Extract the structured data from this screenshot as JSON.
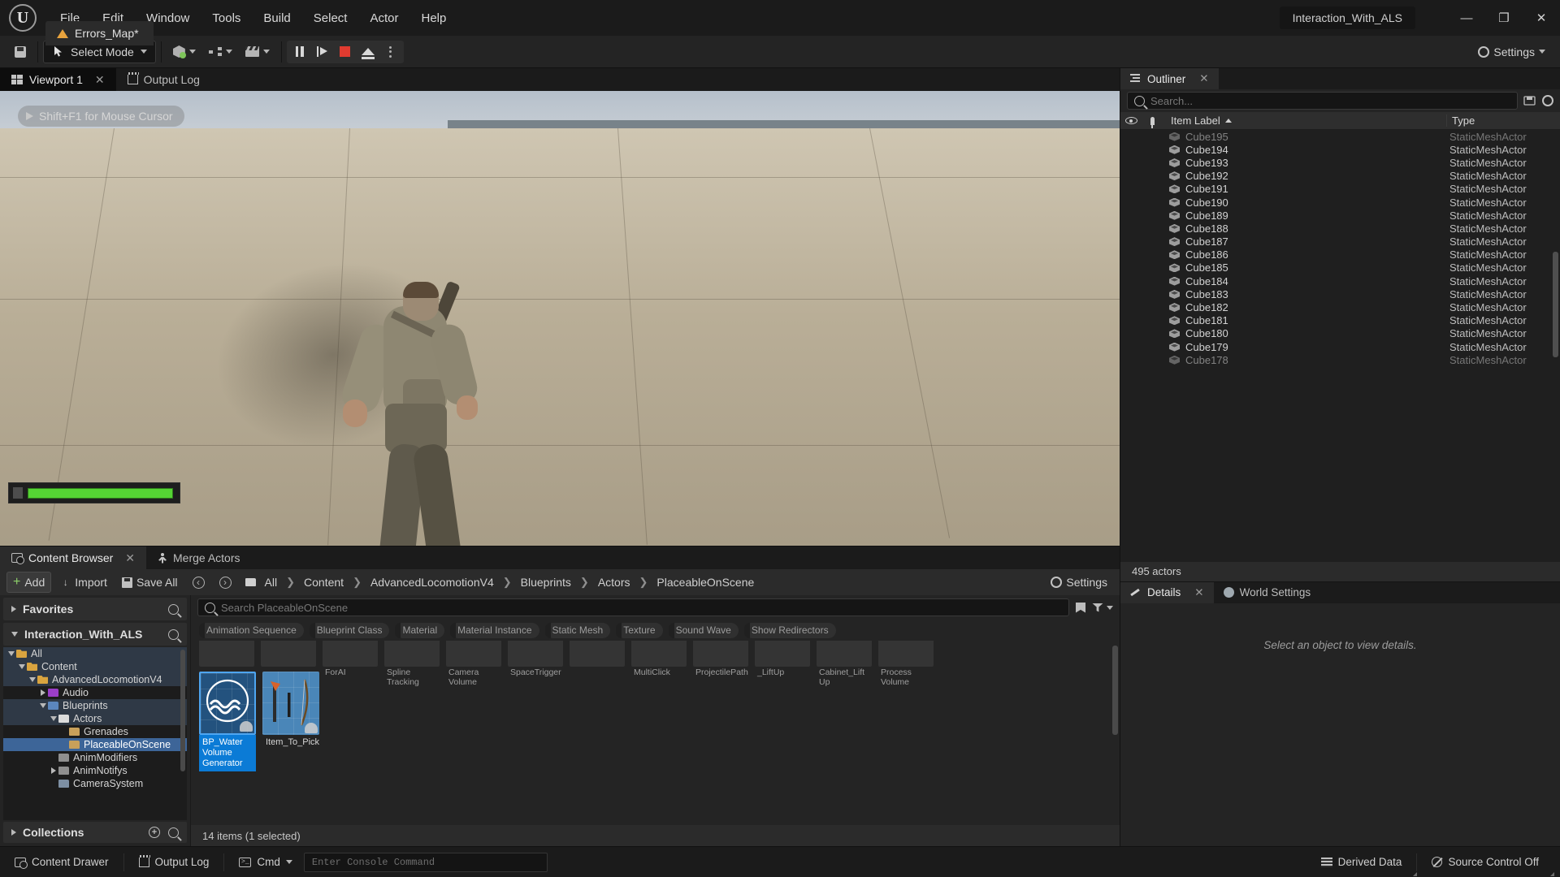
{
  "titlebar": {
    "menu": [
      "File",
      "Edit",
      "Window",
      "Tools",
      "Build",
      "Select",
      "Actor",
      "Help"
    ],
    "project_name": "Interaction_With_ALS",
    "level_tab": "Errors_Map*",
    "minimize": "—",
    "maximize": "❐",
    "close": "✕"
  },
  "toolbar": {
    "save_label": "",
    "mode_label": "Select Mode",
    "settings_label": "Settings",
    "icons": {
      "save": "save-icon",
      "select_mode": "cursor-icon",
      "add_actor": "place-actor-icon",
      "blueprints": "blueprint-icon",
      "cinematics": "cinematics-icon",
      "pause": "pause-icon",
      "step": "step-icon",
      "stop": "stop-icon",
      "eject": "eject-icon",
      "more": "more-options-icon",
      "settings": "gear-icon"
    }
  },
  "viewport": {
    "tabs": [
      {
        "label": "Viewport 1",
        "icon": "viewport-icon",
        "active": true,
        "closable": true
      },
      {
        "label": "Output Log",
        "icon": "output-log-icon",
        "active": false,
        "closable": false
      }
    ],
    "overlay_hint": "Shift+F1 for Mouse Cursor",
    "health_percent": 100
  },
  "outliner": {
    "tab_label": "Outliner",
    "tab_icon": "outliner-icon",
    "close_label": "✕",
    "search_placeholder": "Search...",
    "columns": {
      "eye": "visibility-icon",
      "pin": "pin-icon",
      "item_label": "Item Label",
      "type": "Type"
    },
    "sort_ascending": true,
    "rows": [
      {
        "name": "Cube178",
        "type": "StaticMeshActor",
        "clipped": true
      },
      {
        "name": "Cube179",
        "type": "StaticMeshActor"
      },
      {
        "name": "Cube180",
        "type": "StaticMeshActor"
      },
      {
        "name": "Cube181",
        "type": "StaticMeshActor"
      },
      {
        "name": "Cube182",
        "type": "StaticMeshActor"
      },
      {
        "name": "Cube183",
        "type": "StaticMeshActor"
      },
      {
        "name": "Cube184",
        "type": "StaticMeshActor"
      },
      {
        "name": "Cube185",
        "type": "StaticMeshActor"
      },
      {
        "name": "Cube186",
        "type": "StaticMeshActor"
      },
      {
        "name": "Cube187",
        "type": "StaticMeshActor"
      },
      {
        "name": "Cube188",
        "type": "StaticMeshActor"
      },
      {
        "name": "Cube189",
        "type": "StaticMeshActor"
      },
      {
        "name": "Cube190",
        "type": "StaticMeshActor"
      },
      {
        "name": "Cube191",
        "type": "StaticMeshActor"
      },
      {
        "name": "Cube192",
        "type": "StaticMeshActor"
      },
      {
        "name": "Cube193",
        "type": "StaticMeshActor"
      },
      {
        "name": "Cube194",
        "type": "StaticMeshActor"
      },
      {
        "name": "Cube195",
        "type": "StaticMeshActor",
        "clipped": true
      }
    ],
    "actor_count": "495 actors"
  },
  "details": {
    "tabs": [
      {
        "label": "Details",
        "icon": "details-icon",
        "active": true,
        "closable": true
      },
      {
        "label": "World Settings",
        "icon": "globe-icon",
        "active": false,
        "closable": false
      }
    ],
    "empty_message": "Select an object to view details."
  },
  "content_browser": {
    "tabs": [
      {
        "label": "Content Browser",
        "icon": "content-browser-icon",
        "active": true,
        "closable": true
      },
      {
        "label": "Merge Actors",
        "icon": "merge-actors-icon",
        "active": false,
        "closable": false
      }
    ],
    "toolbar": {
      "add": "Add",
      "import": "Import",
      "save_all": "Save All",
      "back": "back-arrow-icon",
      "forward": "forward-arrow-icon",
      "settings": "Settings"
    },
    "breadcrumbs": [
      "All",
      "Content",
      "AdvancedLocomotionV4",
      "Blueprints",
      "Actors",
      "PlaceableOnScene"
    ],
    "search_placeholder": "Search PlaceableOnScene",
    "filters": [
      "Animation Sequence",
      "Blueprint Class",
      "Material",
      "Material Instance",
      "Static Mesh",
      "Texture",
      "Sound Wave",
      "Show Redirectors"
    ],
    "sidebar": {
      "favorites": "Favorites",
      "project": "Interaction_With_ALS",
      "collections": "Collections",
      "tree": [
        {
          "label": "All",
          "depth": 0,
          "folder": "f-open",
          "expanded": true,
          "highlight": true
        },
        {
          "label": "Content",
          "depth": 1,
          "folder": "f-open",
          "expanded": true,
          "highlight": true
        },
        {
          "label": "AdvancedLocomotionV4",
          "depth": 2,
          "folder": "f-open",
          "expanded": true,
          "highlight": true
        },
        {
          "label": "Audio",
          "depth": 3,
          "folder": "f-purp",
          "expanded": false,
          "collapsible": true
        },
        {
          "label": "Blueprints",
          "depth": 3,
          "folder": "f-blue",
          "expanded": true,
          "highlight": true
        },
        {
          "label": "Actors",
          "depth": 4,
          "folder": "f-white",
          "expanded": true,
          "highlight": true
        },
        {
          "label": "Grenades",
          "depth": 5,
          "folder": "f-tan"
        },
        {
          "label": "PlaceableOnScene",
          "depth": 5,
          "folder": "f-tan",
          "selected": true
        },
        {
          "label": "AnimModifiers",
          "depth": 4,
          "folder": "f-grey"
        },
        {
          "label": "AnimNotifys",
          "depth": 4,
          "folder": "f-grey",
          "collapsible": true
        },
        {
          "label": "CameraSystem",
          "depth": 4,
          "folder": "f-slate"
        }
      ]
    },
    "partial_row": [
      {
        "label": ""
      },
      {
        "label": ""
      },
      {
        "label": "ForAI"
      },
      {
        "label": "Spline Tracking"
      },
      {
        "label": "Camera Volume"
      },
      {
        "label": "SpaceTrigger"
      },
      {
        "label": ""
      },
      {
        "label": "MultiClick"
      },
      {
        "label": "ProjectilePath"
      },
      {
        "label": "_LiftUp"
      },
      {
        "label": "Cabinet_Lift Up"
      },
      {
        "label": "Process Volume"
      }
    ],
    "assets": [
      {
        "name": "BP_Water Volume Generator",
        "selected": true,
        "thumb": "water-volume"
      },
      {
        "name": "Item_To_Pick",
        "selected": false,
        "thumb": "item-to-pick"
      }
    ],
    "status": "14 items (1 selected)"
  },
  "statusbar": {
    "content_drawer": "Content Drawer",
    "output_log": "Output Log",
    "cmd": "Cmd",
    "console_placeholder": "Enter Console Command",
    "derived_data": "Derived Data",
    "source_control": "Source Control Off"
  },
  "colors": {
    "accent_blue": "#0b7bd6",
    "selection_blue": "#3d6598",
    "stop_red": "#e03b30",
    "health_green": "#55d334",
    "folder_orange": "#d9a43f"
  }
}
